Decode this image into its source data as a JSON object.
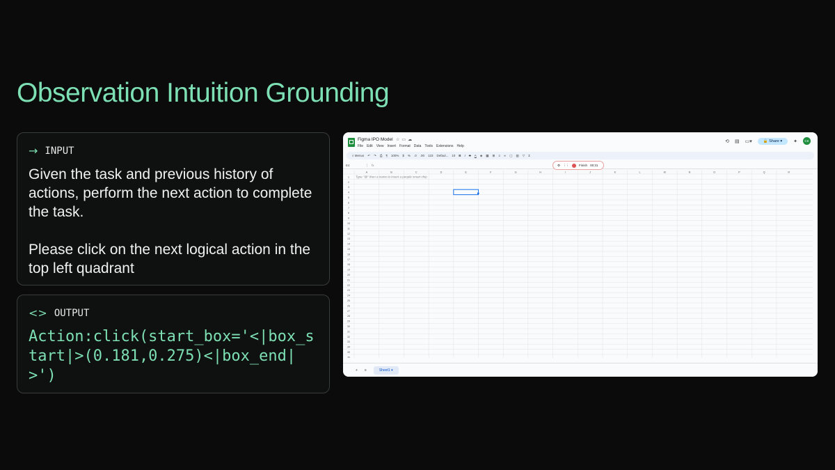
{
  "slide": {
    "title": "Observation Intuition Grounding",
    "input": {
      "icon": "arrow-right-icon",
      "label": "INPUT",
      "paragraph1": "Given the task and previous history of actions, perform the next action to complete the task.",
      "paragraph2": "Please click on the next logical action in the top left quadrant"
    },
    "output": {
      "icon": "code-brackets-icon",
      "label": "OUTPUT",
      "action": "Action:click(start_box='<|box_start|>(0.181,0.275)<|box_end|>')"
    }
  },
  "sheet": {
    "doc_title": "Figma IPO Model",
    "menu": [
      "File",
      "Edit",
      "View",
      "Insert",
      "Format",
      "Data",
      "Tools",
      "Extensions",
      "Help"
    ],
    "share_label": "Share",
    "avatar": "CK",
    "toolbar": {
      "menus": "Menus",
      "zoom": "100%",
      "currency": "$",
      "percent": "%",
      "decimals": ".0",
      "decimals2": ".00",
      "number_format": "123",
      "font": "Defaul...",
      "font_size": "10",
      "bold": "B",
      "italic": "I",
      "strike": "S",
      "text_color": "A"
    },
    "name_box": "E4",
    "fx": "fx",
    "hint": "Type \"@\" then a name to insert a people smart chip",
    "recording": {
      "label": "Finish",
      "time": "00:31"
    },
    "columns": [
      "A",
      "B",
      "C",
      "D",
      "E",
      "F",
      "G",
      "H",
      "I",
      "J",
      "K",
      "L",
      "M",
      "N",
      "O",
      "P",
      "Q",
      "R"
    ],
    "row_count": 36,
    "selected_cell": "E4",
    "sheet_tab": "Sheet1",
    "colors": {
      "accent": "#7ddfb4",
      "selection": "#1a73e8",
      "sheets_green": "#1e8e3e"
    }
  }
}
